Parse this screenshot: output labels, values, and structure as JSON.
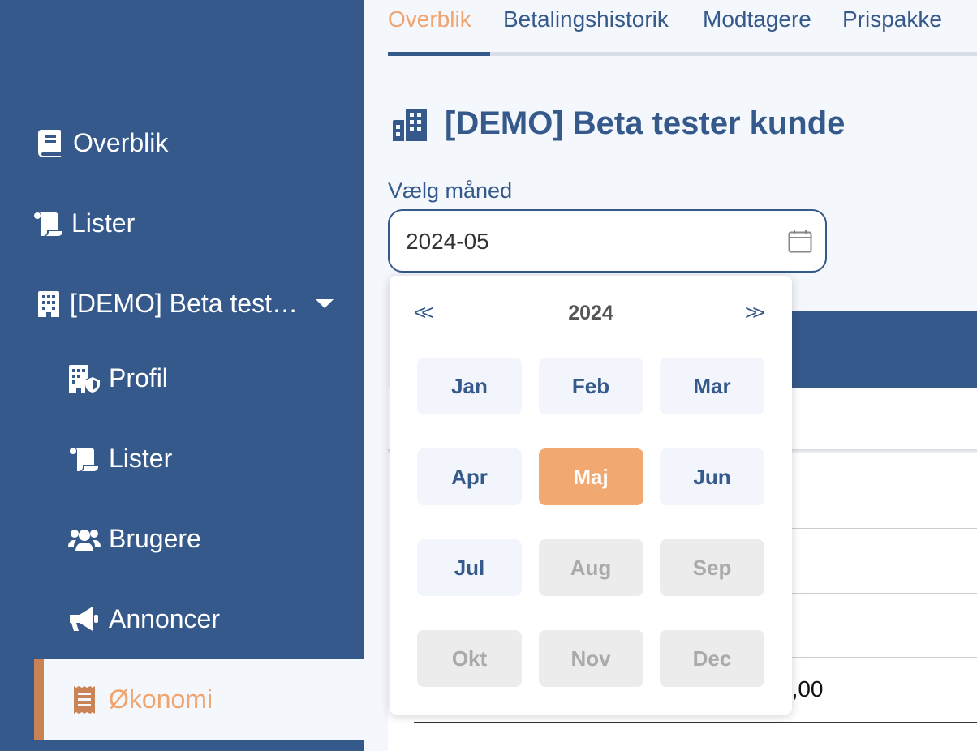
{
  "sidebar": {
    "items": [
      {
        "label": "Overblik",
        "icon": "book-icon"
      },
      {
        "label": "Lister",
        "icon": "scroll-icon"
      },
      {
        "label": "[DEMO] Beta test…",
        "icon": "building-icon"
      },
      {
        "label": "Profil",
        "icon": "building-shield-icon"
      },
      {
        "label": "Lister",
        "icon": "scroll-icon"
      },
      {
        "label": "Brugere",
        "icon": "users-icon"
      },
      {
        "label": "Annoncer",
        "icon": "megaphone-icon"
      },
      {
        "label": "Økonomi",
        "icon": "receipt-icon"
      }
    ]
  },
  "tabs": [
    {
      "label": "Overblik",
      "active": true
    },
    {
      "label": "Betalingshistorik"
    },
    {
      "label": "Modtagere"
    },
    {
      "label": "Prispakke"
    }
  ],
  "header": {
    "title": "[DEMO] Beta tester kunde"
  },
  "month_picker": {
    "label": "Vælg måned",
    "value": "2024-05",
    "year": "2024",
    "prev": "<<",
    "next": ">>",
    "months": [
      {
        "label": "Jan",
        "state": "enabled"
      },
      {
        "label": "Feb",
        "state": "enabled"
      },
      {
        "label": "Mar",
        "state": "enabled"
      },
      {
        "label": "Apr",
        "state": "enabled"
      },
      {
        "label": "Maj",
        "state": "selected"
      },
      {
        "label": "Jun",
        "state": "enabled"
      },
      {
        "label": "Jul",
        "state": "enabled"
      },
      {
        "label": "Aug",
        "state": "disabled"
      },
      {
        "label": "Sep",
        "state": "disabled"
      },
      {
        "label": "Okt",
        "state": "disabled"
      },
      {
        "label": "Nov",
        "state": "disabled"
      },
      {
        "label": "Dec",
        "state": "disabled"
      }
    ]
  },
  "table": {
    "visible_value": "0,00"
  },
  "colors": {
    "primary": "#35598a",
    "accent": "#f0a46f",
    "selected_month": "#f2a871"
  }
}
